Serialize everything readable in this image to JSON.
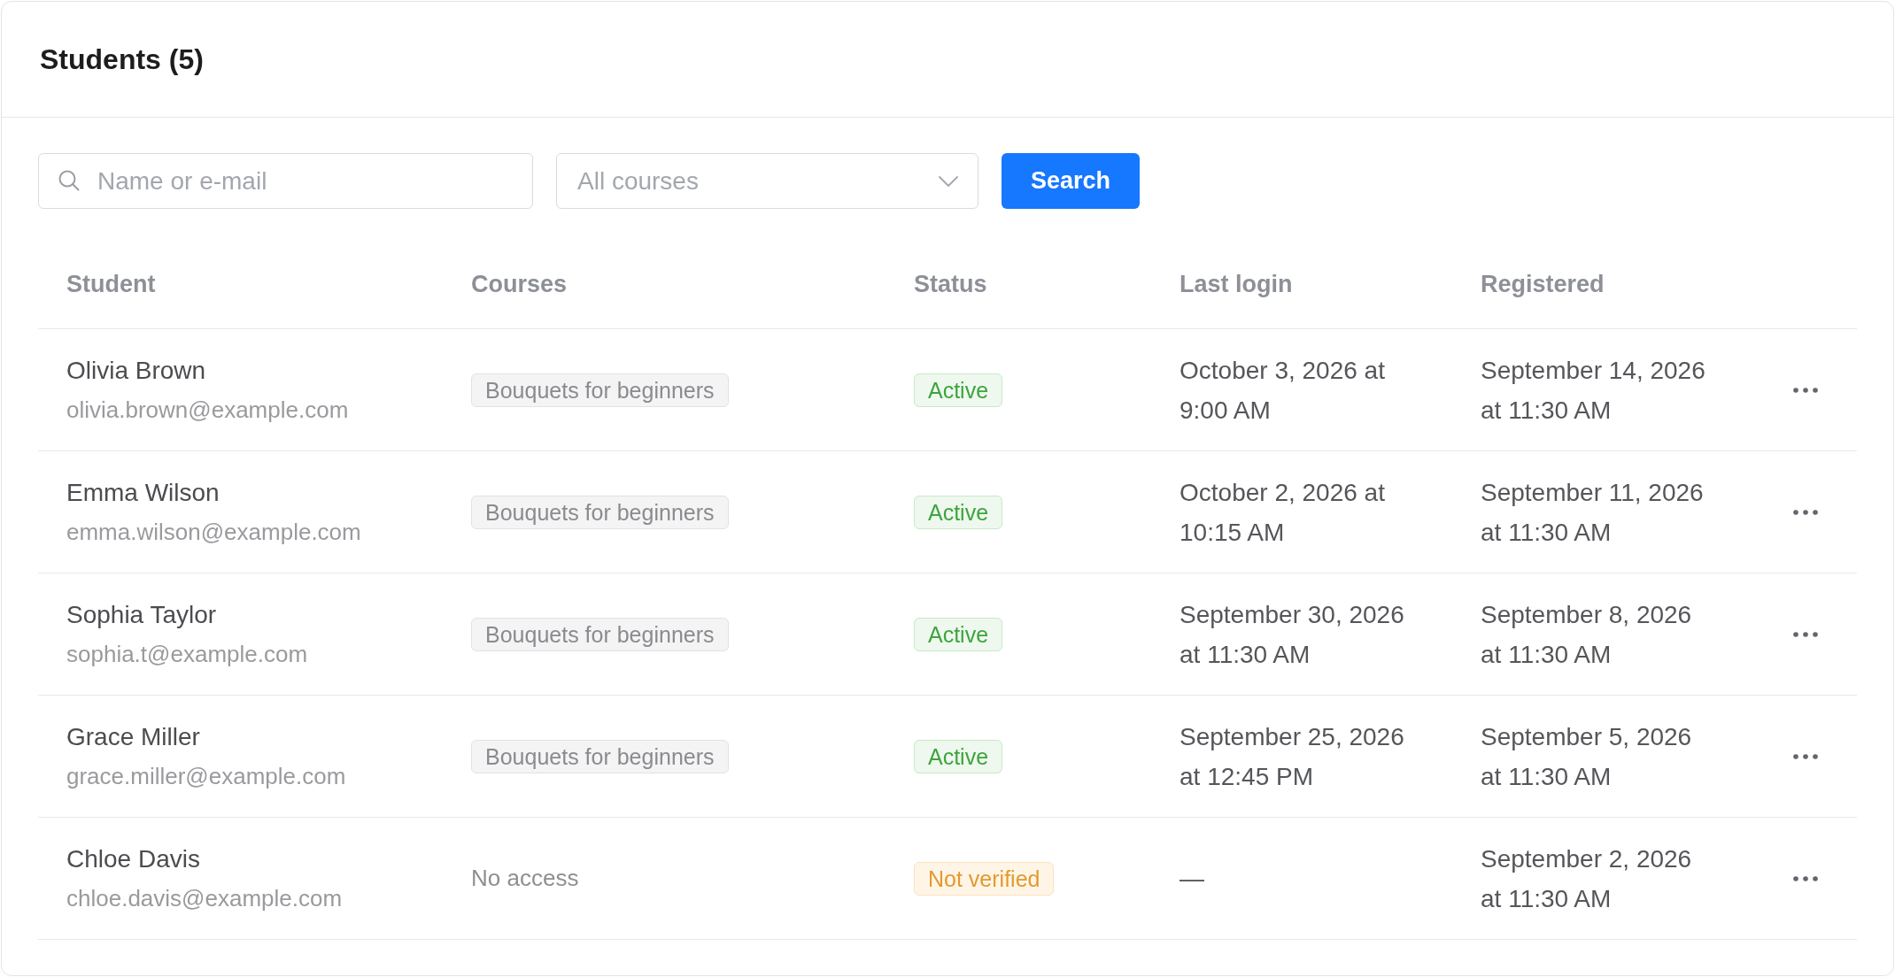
{
  "panel": {
    "title": "Students (5)"
  },
  "filters": {
    "search": {
      "placeholder": "Name or e-mail"
    },
    "course_select": {
      "placeholder": "All courses"
    },
    "search_button": "Search"
  },
  "table": {
    "columns": [
      "Student",
      "Courses",
      "Status",
      "Last login",
      "Registered"
    ],
    "rows": [
      {
        "name": "Olivia Brown",
        "email": "olivia.brown@example.com",
        "courses": [
          "Bouquets for beginners"
        ],
        "status": {
          "label": "Active",
          "kind": "success"
        },
        "last_login": "October 3, 2026 at 9:00 AM",
        "registered": "September 14, 2026 at 11:30 AM"
      },
      {
        "name": "Emma Wilson",
        "email": "emma.wilson@example.com",
        "courses": [
          "Bouquets for beginners"
        ],
        "status": {
          "label": "Active",
          "kind": "success"
        },
        "last_login": "October 2, 2026 at 10:15 AM",
        "registered": "September 11, 2026 at 11:30 AM"
      },
      {
        "name": "Sophia Taylor",
        "email": "sophia.t@example.com",
        "courses": [
          "Bouquets for beginners"
        ],
        "status": {
          "label": "Active",
          "kind": "success"
        },
        "last_login": "September 30, 2026 at 11:30 AM",
        "registered": "September 8, 2026 at 11:30 AM"
      },
      {
        "name": "Grace Miller",
        "email": "grace.miller@example.com",
        "courses": [
          "Bouquets for beginners"
        ],
        "status": {
          "label": "Active",
          "kind": "success"
        },
        "last_login": "September 25, 2026 at 12:45 PM",
        "registered": "September 5, 2026 at 11:30 AM"
      },
      {
        "name": "Chloe Davis",
        "email": "chloe.davis@example.com",
        "courses_note": "No access",
        "status": {
          "label": "Not verified",
          "kind": "warning"
        },
        "last_login": "—",
        "registered": "September 2, 2026 at 11:30 AM"
      }
    ]
  }
}
